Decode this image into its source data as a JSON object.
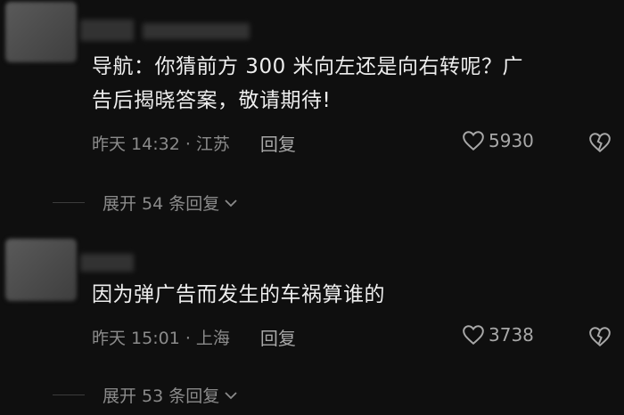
{
  "comments": [
    {
      "text_line1": "导航：你猜前方 300 米向左还是向右转呢？广",
      "text_line2": "告后揭晓答案，敬请期待!",
      "time": "昨天 14:32 ·",
      "location": "江苏",
      "reply_label": "回复",
      "likes": "5930",
      "expand_label": "展开 54 条回复"
    },
    {
      "text_line1": "因为弹广告而发生的车祸算谁的",
      "time": "昨天 15:01 ·",
      "location": "上海",
      "reply_label": "回复",
      "likes": "3738",
      "expand_label": "展开 53 条回复"
    }
  ],
  "icons": {
    "like": "heart-outline-icon",
    "dislike": "broken-heart-icon",
    "expand": "chevron-down-icon"
  },
  "colors": {
    "background": "#0f0f0f",
    "text": "#ededed",
    "meta": "#8b8b8b"
  }
}
